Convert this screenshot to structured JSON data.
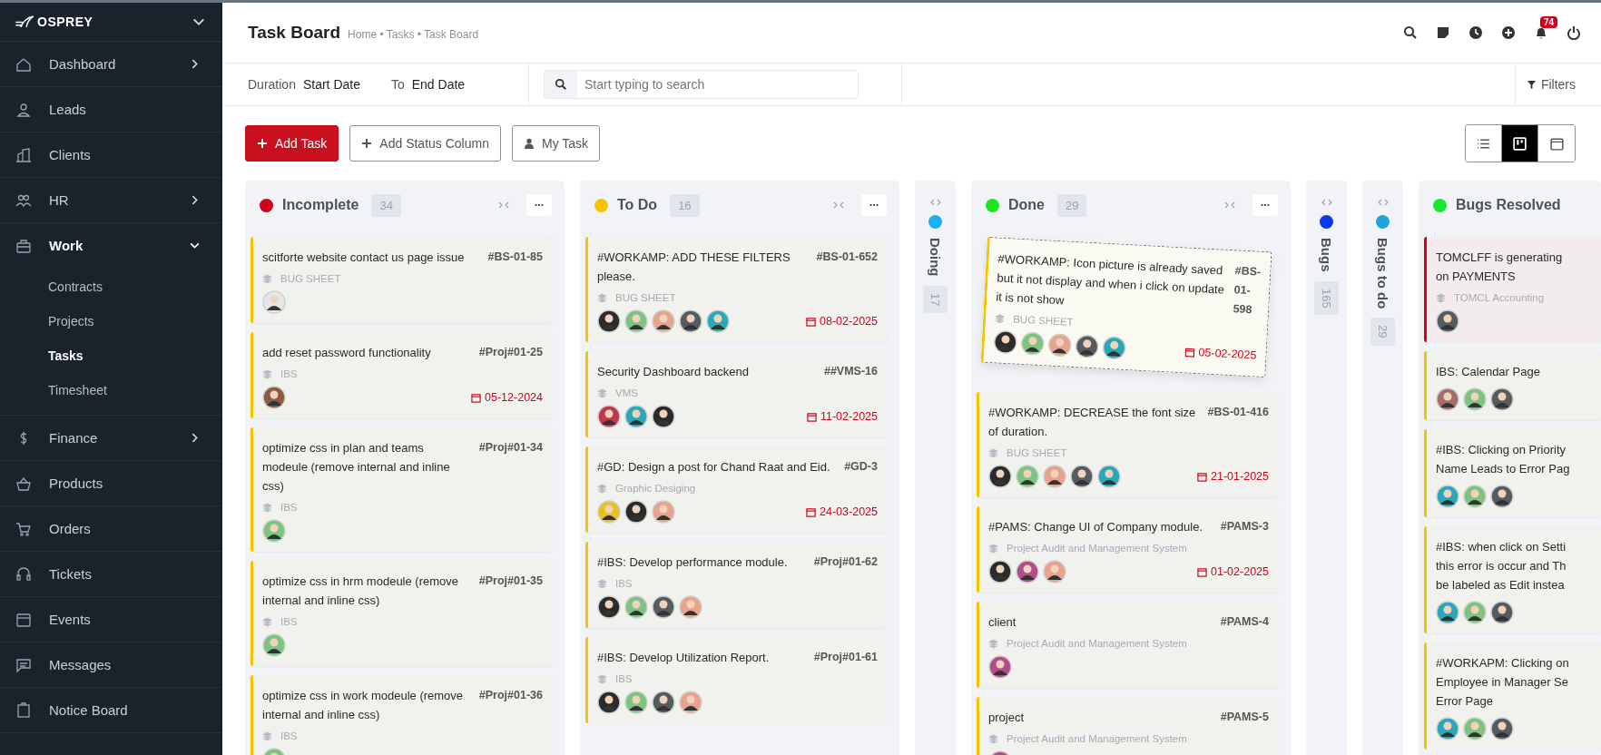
{
  "sidebar": {
    "logo": "OSPREY",
    "items": [
      {
        "label": "Dashboard",
        "expanded": false
      },
      {
        "label": "Leads"
      },
      {
        "label": "Clients"
      },
      {
        "label": "HR",
        "expanded": false
      },
      {
        "label": "Work",
        "expanded": true,
        "children": [
          {
            "label": "Contracts",
            "selected": false
          },
          {
            "label": "Projects",
            "selected": false
          },
          {
            "label": "Tasks",
            "selected": true
          },
          {
            "label": "Timesheet",
            "selected": false
          }
        ]
      },
      {
        "label": "Finance",
        "expanded": false
      },
      {
        "label": "Products"
      },
      {
        "label": "Orders"
      },
      {
        "label": "Tickets"
      },
      {
        "label": "Events"
      },
      {
        "label": "Messages"
      },
      {
        "label": "Notice Board"
      }
    ]
  },
  "header": {
    "title": "Task Board",
    "breadcrumb": "Home • Tasks • Task Board",
    "notification_count": "74"
  },
  "filter_bar": {
    "duration_label": "Duration",
    "start_date": "Start Date",
    "to_label": "To",
    "end_date": "End Date",
    "search": {
      "placeholder": "Start typing to search"
    },
    "filters_button": "Filters"
  },
  "toolbar": {
    "buttons": [
      "Add Task",
      "Add Status Column",
      "My Task"
    ],
    "views": [
      {
        "selected": false
      },
      {
        "selected": true
      },
      {
        "selected": false
      }
    ]
  },
  "columns": [
    {
      "kind": "expanded",
      "title": "Incomplete",
      "color": "#d0021b",
      "count": "34",
      "cards": [
        {
          "title": "scitforte website contact us page issue",
          "code": "#BS-01-85",
          "project": "BUG SHEET",
          "avatars": [
            {
              "color": "#e6e6e6"
            }
          ],
          "flagged": false
        },
        {
          "title": "add reset password functionality",
          "code": "#Proj#01-25",
          "project": "IBS",
          "avatars": [
            {
              "color": "#8a5a44"
            }
          ],
          "due": "05-12-2024",
          "flagged": false
        },
        {
          "title": "optimize css in plan and teams modeule (remove internal and inline css)",
          "code": "#Proj#01-34",
          "project": "IBS",
          "avatars": [
            {
              "color": "#7cc47f"
            }
          ],
          "flagged": false
        },
        {
          "title": "optimize css in hrm modeule (remove internal and inline css)",
          "code": "#Proj#01-35",
          "project": "IBS",
          "avatars": [
            {
              "color": "#7cc47f"
            }
          ],
          "flagged": false
        },
        {
          "title": "optimize css in work modeule (remove internal and inline css)",
          "code": "#Proj#01-36",
          "project": "IBS",
          "avatars": [
            {
              "color": "#7cc47f"
            }
          ],
          "flagged": false
        }
      ]
    },
    {
      "kind": "expanded",
      "title": "To Do",
      "color": "#f5c400",
      "count": "16",
      "cards": [
        {
          "title": "#WORKAMP: ADD THESE FILTERS please.",
          "code": "#BS-01-652",
          "project": "BUG SHEET",
          "avatars": [
            {
              "color": "#2b2b2b"
            },
            {
              "color": "#7cc47f"
            },
            {
              "color": "#e8a48a"
            },
            {
              "color": "#555c60"
            },
            {
              "color": "#2aa8b8"
            }
          ],
          "due": "08-02-2025",
          "flagged": false
        },
        {
          "title": "Security Dashboard backend",
          "code": "##VMS-16",
          "project": "VMS",
          "avatars": [
            {
              "color": "#c0394b"
            },
            {
              "color": "#2aa8b8"
            },
            {
              "color": "#2b2b2b"
            }
          ],
          "due": "11-02-2025",
          "flagged": false
        },
        {
          "title": "#GD: Design a post for Chand Raat and Eid.",
          "code": "#GD-3",
          "project": "Graphic Desiging",
          "avatars": [
            {
              "color": "#e8c020"
            },
            {
              "color": "#2b2b2b"
            },
            {
              "color": "#e8a48a"
            }
          ],
          "due": "24-03-2025",
          "flagged": false
        },
        {
          "title": "#IBS: Develop performance module.",
          "code": "#Proj#01-62",
          "project": "IBS",
          "avatars": [
            {
              "color": "#2b2b2b"
            },
            {
              "color": "#7cc47f"
            },
            {
              "color": "#555c60"
            },
            {
              "color": "#e8a48a"
            }
          ],
          "flagged": false
        },
        {
          "title": "#IBS: Develop Utilization Report.",
          "code": "#Proj#01-61",
          "project": "IBS",
          "avatars": [
            {
              "color": "#2b2b2b"
            },
            {
              "color": "#7cc47f"
            },
            {
              "color": "#555c60"
            },
            {
              "color": "#e8a48a"
            }
          ],
          "flagged": false
        }
      ]
    },
    {
      "kind": "collapsed",
      "title": "Doing",
      "color": "#1bb0f0",
      "count": "17"
    },
    {
      "kind": "expanded",
      "title": "Done",
      "color": "#1ee61e",
      "count": "29",
      "cards": [
        {
          "title": "#WORKAMP: Icon picture is already saved but it not display and when i click on update it is not show",
          "code": "#BS-01-598",
          "project": "BUG SHEET",
          "avatars": [
            {
              "color": "#2b2b2b"
            },
            {
              "color": "#7cc47f"
            },
            {
              "color": "#e8a48a"
            },
            {
              "color": "#555c60"
            },
            {
              "color": "#2aa8b8"
            }
          ],
          "due": "05-02-2025",
          "flagged": false,
          "dragging": true
        },
        {
          "title": "#WORKAMP: DECREASE the font size of duration.",
          "code": "#BS-01-416",
          "project": "BUG SHEET",
          "avatars": [
            {
              "color": "#2b2b2b"
            },
            {
              "color": "#7cc47f"
            },
            {
              "color": "#e8a48a"
            },
            {
              "color": "#555c60"
            },
            {
              "color": "#2aa8b8"
            }
          ],
          "due": "21-01-2025",
          "flagged": false
        },
        {
          "title": "#PAMS: Change UI of Company module.",
          "code": "#PAMS-3",
          "project": "Project Audit and Management System",
          "avatars": [
            {
              "color": "#2b2b2b"
            },
            {
              "color": "#b04d8a"
            },
            {
              "color": "#e8a48a"
            }
          ],
          "due": "01-02-2025",
          "flagged": false
        },
        {
          "title": "client",
          "code": "#PAMS-4",
          "project": "Project Audit and Management System",
          "avatars": [
            {
              "color": "#b04d8a"
            }
          ],
          "flagged": false
        },
        {
          "title": "project",
          "code": "#PAMS-5",
          "project": "Project Audit and Management System",
          "avatars": [
            {
              "color": "#b04d8a"
            }
          ],
          "flagged": false
        }
      ]
    },
    {
      "kind": "collapsed",
      "title": "Bugs",
      "color": "#0a36f5",
      "count": "165"
    },
    {
      "kind": "collapsed",
      "title": "Bugs to do",
      "color": "#1ea7d6",
      "count": "29"
    },
    {
      "kind": "expanded",
      "title": "Bugs Resolved",
      "color": "#19e830",
      "cards": [
        {
          "title_lines": [
            "TOMCLFF is generating",
            "on PAYMENTS"
          ],
          "project": "TOMCL Accounting",
          "avatars": [
            {
              "color": "#555c60"
            }
          ],
          "flagged": true
        },
        {
          "title_lines": [
            "IBS: Calendar Page"
          ],
          "avatars": [
            {
              "color": "#a86b6b"
            },
            {
              "color": "#7cc47f"
            },
            {
              "color": "#555c60"
            }
          ],
          "flagged": false
        },
        {
          "title_lines": [
            "#IBS: Clicking on Priority",
            "Name Leads to Error Pag"
          ],
          "avatars": [
            {
              "color": "#2aa8b8"
            },
            {
              "color": "#7cc47f"
            },
            {
              "color": "#555c60"
            }
          ],
          "flagged": false
        },
        {
          "title_lines": [
            "#IBS: when click on Setti",
            "this error is occur and Th",
            "be labeled as Edit instea"
          ],
          "avatars": [
            {
              "color": "#2aa8b8"
            },
            {
              "color": "#7cc47f"
            },
            {
              "color": "#555c60"
            }
          ],
          "flagged": false
        },
        {
          "title_lines": [
            "#WORKAPM: Clicking on",
            "Employee in Manager Se",
            "Error Page"
          ],
          "avatars": [
            {
              "color": "#2aa8b8"
            },
            {
              "color": "#7cc47f"
            },
            {
              "color": "#555c60"
            }
          ],
          "flagged": false
        }
      ]
    }
  ]
}
